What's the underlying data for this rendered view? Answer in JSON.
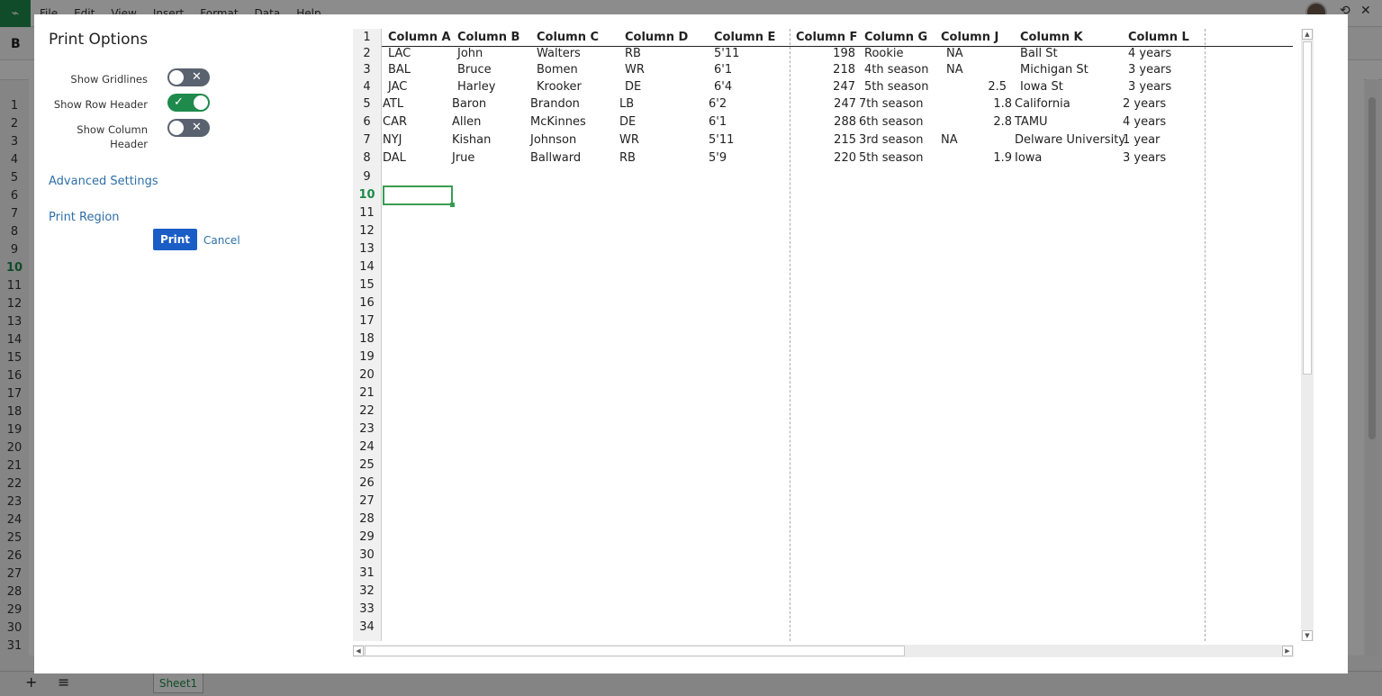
{
  "app": {
    "menu": [
      "File",
      "Edit",
      "View",
      "Insert",
      "Format",
      "Data",
      "Help"
    ],
    "toolbar_bold": "B",
    "row_numbers": [
      "1",
      "2",
      "3",
      "4",
      "5",
      "6",
      "7",
      "8",
      "9",
      "10",
      "11",
      "12",
      "13",
      "14",
      "15",
      "16",
      "17",
      "18",
      "19",
      "20",
      "21",
      "22",
      "23",
      "24",
      "25",
      "26",
      "27",
      "28",
      "29",
      "30",
      "31"
    ],
    "active_row": "10",
    "sheet_tab": "Sheet1",
    "add_sheet_icon": "+",
    "sheet_list_icon": "≡"
  },
  "dialog": {
    "title": "Print Options",
    "options": {
      "show_gridlines": {
        "label": "Show Gridlines",
        "state": "off"
      },
      "show_row_header": {
        "label": "Show Row Header",
        "state": "on"
      },
      "show_column_header": {
        "label": "Show Column Header",
        "state": "off"
      }
    },
    "advanced_settings": "Advanced Settings",
    "print_region": "Print Region",
    "print_button": "Print",
    "cancel_link": "Cancel",
    "toggle_on_mark": "✓",
    "toggle_off_mark": "✕"
  },
  "preview": {
    "row_numbers": [
      "1",
      "2",
      "3",
      "4",
      "5",
      "6",
      "7",
      "8",
      "9",
      "10",
      "11",
      "12",
      "13",
      "14",
      "15",
      "16",
      "17",
      "18",
      "19",
      "20",
      "21",
      "22",
      "23",
      "24",
      "25",
      "26",
      "27",
      "28",
      "29",
      "30",
      "31",
      "32",
      "33",
      "34"
    ],
    "active_row": "10",
    "headers": [
      "Column A",
      "Column B",
      "Column C",
      "Column D",
      "Column E",
      "Column F",
      "Column G",
      "Column J",
      "Column K",
      "Column L"
    ],
    "rows": [
      [
        "LAC",
        "John",
        "Walters",
        "RB",
        "5'11",
        "198",
        "Rookie",
        "NA",
        "Ball St",
        "4 years"
      ],
      [
        "BAL",
        "Bruce",
        "Bomen",
        "WR",
        "6'1",
        "218",
        "4th season",
        "NA",
        "Michigan St",
        "3 years"
      ],
      [
        "JAC",
        "Harley",
        "Krooker",
        "DE",
        "6'4",
        "247",
        "5th season",
        "2.5",
        "Iowa St",
        "3 years"
      ],
      [
        "ATL",
        "Baron",
        "Brandon",
        "LB",
        "6'2",
        "247",
        "7th season",
        "1.8",
        "California",
        "2 years"
      ],
      [
        "CAR",
        "Allen",
        "McKinnes",
        "DE",
        "6'1",
        "288",
        "6th season",
        "2.8",
        "TAMU",
        "4 years"
      ],
      [
        "NYJ",
        "Kishan",
        "Johnson",
        "WR",
        "5'11",
        "215",
        "3rd season",
        "NA",
        "Delware University",
        "1 year"
      ],
      [
        "DAL",
        "Jrue",
        "Ballward",
        "RB",
        "5'9",
        "220",
        "5th season",
        "1.9",
        "Iowa",
        "3 years"
      ]
    ]
  }
}
